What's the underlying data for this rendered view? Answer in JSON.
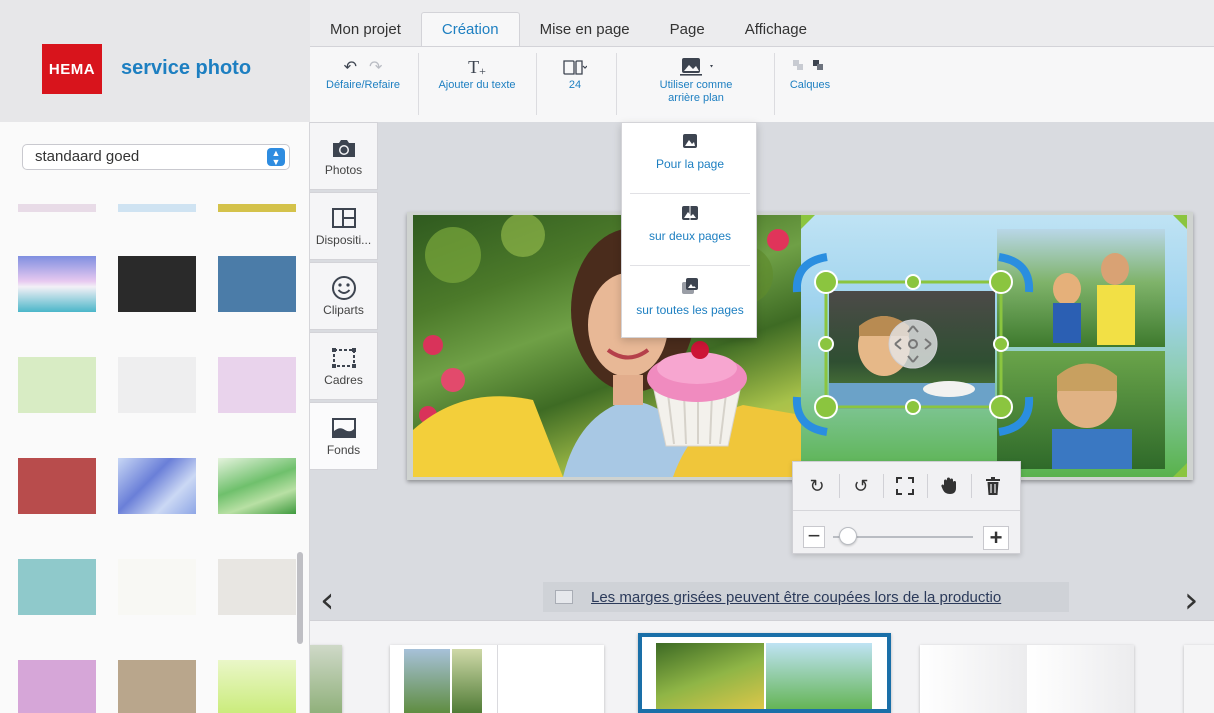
{
  "app": {
    "logo_text": "HEMA",
    "brand": "service photo",
    "colors": {
      "accent": "#1d7fc1",
      "logo_red": "#d8141c",
      "selection_green": "#8bc53f",
      "handle_blue": "#2a8ee0"
    }
  },
  "tabs": [
    {
      "label": "Mon projet",
      "active": false
    },
    {
      "label": "Création",
      "active": true
    },
    {
      "label": "Mise en page",
      "active": false
    },
    {
      "label": "Page",
      "active": false
    },
    {
      "label": "Affichage",
      "active": false
    }
  ],
  "toolbar": {
    "undo_redo": "Défaire/Refaire",
    "add_text": "Ajouter du texte",
    "page_count": "24",
    "use_as_background": "Utiliser comme arrière plan",
    "layers": "Calques"
  },
  "background_dropdown": {
    "for_page": "Pour la page",
    "two_pages": "sur deux pages",
    "all_pages": "sur toutes les pages"
  },
  "sidebar": {
    "preset": "standaard goed",
    "swatches": [
      "#e8dbe7",
      "#cfe3f2",
      "#d4c24a",
      "#8e9de2",
      "#2a2a2a",
      "#4b7ca8",
      "#d8ecc4",
      "#eeeeef",
      "#e9d3ec",
      "#b84c4c",
      "#8aa3d9",
      "#7fc48a",
      "#8fc9cb",
      "#f8f8f4",
      "#e8e6e2",
      "#d6a6d8",
      "#b9a68c",
      "#d4ee9c"
    ]
  },
  "categories": [
    {
      "label": "Photos",
      "icon": "camera-icon"
    },
    {
      "label": "Dispositi...",
      "icon": "layout-icon"
    },
    {
      "label": "Cliparts",
      "icon": "smiley-icon"
    },
    {
      "label": "Cadres",
      "icon": "frame-icon"
    },
    {
      "label": "Fonds",
      "icon": "background-icon"
    }
  ],
  "canvas": {
    "margin_notice": "Les marges grisées peuvent être coupées lors de la productio"
  }
}
